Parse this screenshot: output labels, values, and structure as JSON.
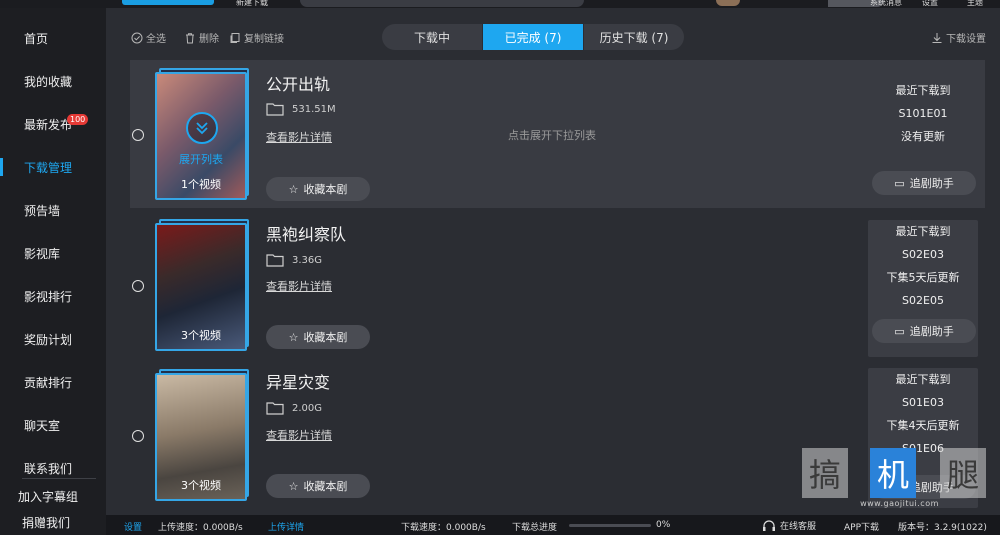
{
  "topbar": {
    "new_download": "新建下载",
    "links": [
      "系统消息",
      "设置",
      "主题"
    ]
  },
  "sidebar": {
    "items": [
      {
        "label": "首页"
      },
      {
        "label": "我的收藏"
      },
      {
        "label": "最新发布",
        "badge": "100"
      },
      {
        "label": "下载管理",
        "active": true
      },
      {
        "label": "预告墙"
      },
      {
        "label": "影视库"
      },
      {
        "label": "影视排行"
      },
      {
        "label": "奖励计划"
      },
      {
        "label": "贡献排行"
      },
      {
        "label": "聊天室"
      },
      {
        "label": "联系我们"
      },
      {
        "label": "加入字幕组"
      },
      {
        "label": "捐赠我们"
      }
    ]
  },
  "toolbar": {
    "select_all": "全选",
    "delete": "删除",
    "copy_link": "复制链接",
    "download_settings": "下载设置"
  },
  "tabs": [
    {
      "label": "下载中"
    },
    {
      "label": "已完成 (7)",
      "active": true
    },
    {
      "label": "历史下载 (7)"
    }
  ],
  "rows": [
    {
      "title": "公开出轨",
      "size": "531.51M",
      "detail": "查看影片详情",
      "fav": "收藏本剧",
      "count": "1个视频",
      "expand_label": "展开列表",
      "hint": "点击展开下拉列表",
      "info": [
        "最近下载到",
        "S101E01",
        "没有更新"
      ],
      "track": "追剧助手"
    },
    {
      "title": "黑袍纠察队",
      "size": "3.36G",
      "detail": "查看影片详情",
      "fav": "收藏本剧",
      "count": "3个视频",
      "info": [
        "最近下载到",
        "S02E03",
        "下集5天后更新",
        "S02E05"
      ],
      "track": "追剧助手"
    },
    {
      "title": "异星灾变",
      "size": "2.00G",
      "detail": "查看影片详情",
      "fav": "收藏本剧",
      "count": "3个视频",
      "info": [
        "最近下载到",
        "S01E03",
        "下集4天后更新",
        "S01E06"
      ],
      "track": "追剧助手"
    }
  ],
  "bottom": {
    "settings": "设置",
    "upload_speed": "上传速度：0.000B/s",
    "upload_detail": "上传详情",
    "download_speed": "下载速度：0.000B/s",
    "total_progress_label": "下载总进度",
    "total_progress_value": "0%",
    "total_progress": 0,
    "online_service": "在线客服",
    "app_download": "APP下载",
    "version": "版本号：3.2.9(1022)"
  },
  "watermark": {
    "chars": [
      "搞",
      "机",
      "腿"
    ],
    "url": "www.gaojitui.com"
  },
  "colors": {
    "accent": "#1ea7f0",
    "badge": "#e53935"
  }
}
